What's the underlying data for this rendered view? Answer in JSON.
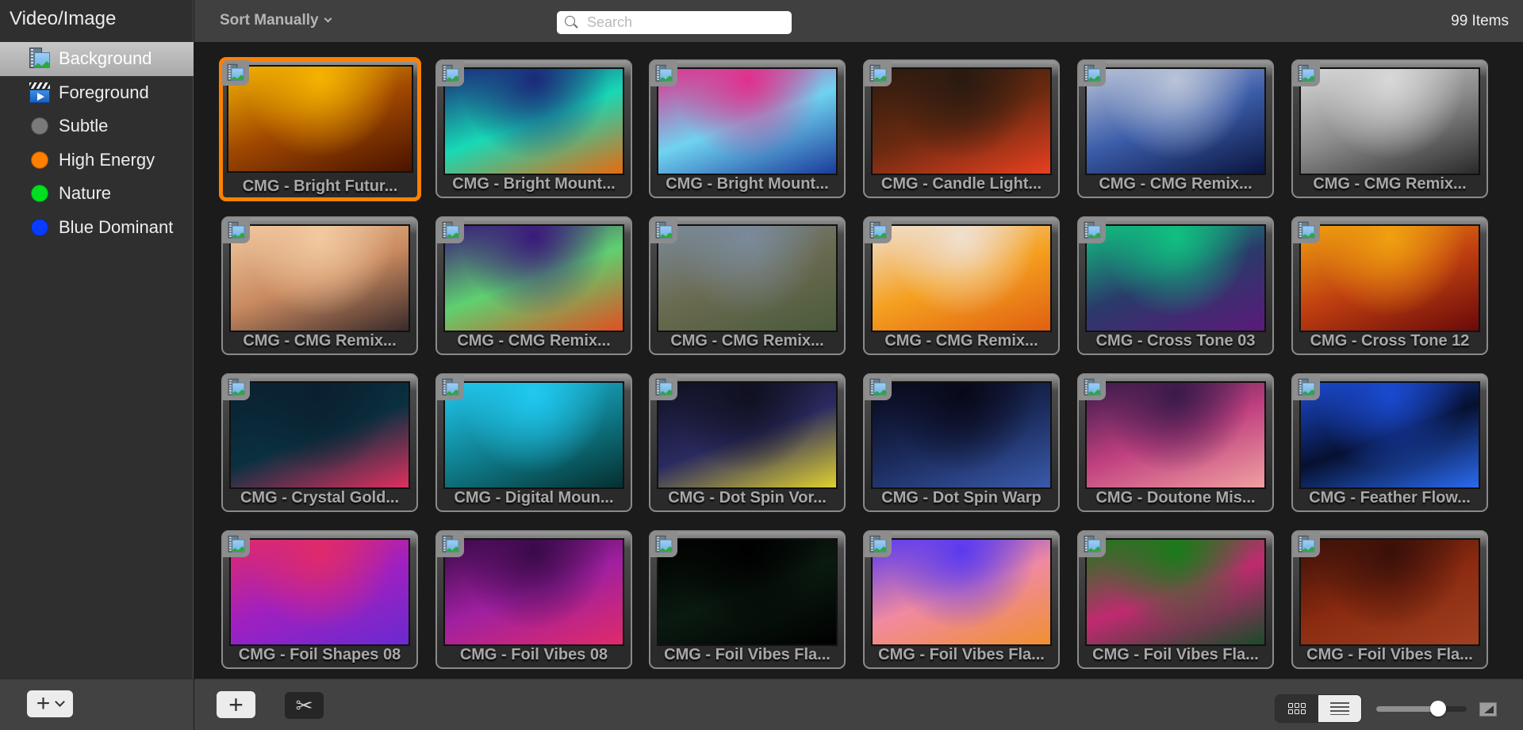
{
  "sidebar": {
    "title": "Video/Image",
    "items": [
      {
        "label": "Background",
        "icon": "background-image-icon",
        "selected": true
      },
      {
        "label": "Foreground",
        "icon": "clapperboard-video-icon",
        "selected": false
      },
      {
        "label": "Subtle",
        "icon": "color-dot",
        "color": "#7a7a7a",
        "selected": false
      },
      {
        "label": "High Energy",
        "icon": "color-dot",
        "color": "#ff7f00",
        "selected": false
      },
      {
        "label": "Nature",
        "icon": "color-dot",
        "color": "#00e020",
        "selected": false
      },
      {
        "label": "Blue Dominant",
        "icon": "color-dot",
        "color": "#0a3cff",
        "selected": false
      }
    ],
    "add_menu_icon": "plus-icon"
  },
  "header": {
    "sort_label": "Sort Manually",
    "search_placeholder": "Search",
    "search_value": "",
    "item_count": "99 Items"
  },
  "grid": {
    "selected_index": 0,
    "accent_color": "#ff8000",
    "items": [
      {
        "label": "CMG - Bright Futur...",
        "colors": [
          "#f5b300",
          "#a04800",
          "#4a1300"
        ]
      },
      {
        "label": "CMG - Bright Mount...",
        "colors": [
          "#1a2a7a",
          "#18d9b5",
          "#e86a10"
        ]
      },
      {
        "label": "CMG - Bright Mount...",
        "colors": [
          "#e0308c",
          "#6fd3f0",
          "#1b3b9b"
        ]
      },
      {
        "label": "CMG - Candle Light...",
        "colors": [
          "#2a1a10",
          "#6b2a10",
          "#e84020"
        ]
      },
      {
        "label": "CMG - CMG Remix...",
        "colors": [
          "#b9c3d8",
          "#3b5ca8",
          "#0a1540"
        ]
      },
      {
        "label": "CMG - CMG Remix...",
        "colors": [
          "#d8d8d8",
          "#8a8a8a",
          "#2a2a2a"
        ]
      },
      {
        "label": "CMG - CMG Remix...",
        "colors": [
          "#f2c9a0",
          "#c98a60",
          "#3a2a2a"
        ]
      },
      {
        "label": "CMG - CMG Remix...",
        "colors": [
          "#3a1a7a",
          "#5fd070",
          "#e05020"
        ]
      },
      {
        "label": "CMG - CMG Remix...",
        "colors": [
          "#7a8a9a",
          "#6a6a50",
          "#4a5a3a"
        ]
      },
      {
        "label": "CMG - CMG Remix...",
        "colors": [
          "#f0e0d0",
          "#f5a020",
          "#e06010"
        ]
      },
      {
        "label": "CMG - Cross Tone 03",
        "colors": [
          "#10c080",
          "#2a3a6a",
          "#5a1a7a"
        ]
      },
      {
        "label": "CMG - Cross Tone 12",
        "colors": [
          "#f0a010",
          "#c04010",
          "#6a0a0a"
        ]
      },
      {
        "label": "CMG - Crystal Gold...",
        "colors": [
          "#0a2030",
          "#0a3040",
          "#e03060"
        ]
      },
      {
        "label": "CMG - Digital Moun...",
        "colors": [
          "#20c8f0",
          "#108090",
          "#043030"
        ]
      },
      {
        "label": "CMG - Dot Spin Vor...",
        "colors": [
          "#101020",
          "#2a2a60",
          "#e0d030"
        ]
      },
      {
        "label": "CMG - Dot Spin Warp",
        "colors": [
          "#080818",
          "#1a2a5a",
          "#3a5aaa"
        ]
      },
      {
        "label": "CMG - Doutone Mis...",
        "colors": [
          "#3a1a4a",
          "#c04080",
          "#f0a0a0"
        ]
      },
      {
        "label": "CMG - Feather Flow...",
        "colors": [
          "#1a4ad0",
          "#061030",
          "#2a6af0"
        ]
      },
      {
        "label": "CMG - Foil Shapes 08",
        "colors": [
          "#e02a6a",
          "#a020c0",
          "#6a2ad0"
        ]
      },
      {
        "label": "CMG - Foil Vibes 08",
        "colors": [
          "#3a0a4a",
          "#a020a0",
          "#e02a6a"
        ]
      },
      {
        "label": "CMG - Foil Vibes Fla...",
        "colors": [
          "#000000",
          "#0a1a10",
          "#000000"
        ]
      },
      {
        "label": "CMG - Foil Vibes Fla...",
        "colors": [
          "#5a3af0",
          "#f08aa0",
          "#f09030"
        ]
      },
      {
        "label": "CMG - Foil Vibes Fla...",
        "colors": [
          "#1a7a1a",
          "#c02a70",
          "#1a4a2a"
        ]
      },
      {
        "label": "CMG - Foil Vibes Fla...",
        "colors": [
          "#3a1008",
          "#8a2a10",
          "#a04020"
        ]
      }
    ]
  },
  "footer": {
    "add_icon": "plus-icon",
    "cut_icon": "scissors-icon",
    "view_modes": [
      {
        "name": "grid",
        "icon": "grid-icon",
        "active": false
      },
      {
        "name": "list",
        "icon": "list-icon",
        "active": true
      }
    ],
    "thumbnail_size": 0.68,
    "size_icon": "thumbnail-size-icon"
  }
}
